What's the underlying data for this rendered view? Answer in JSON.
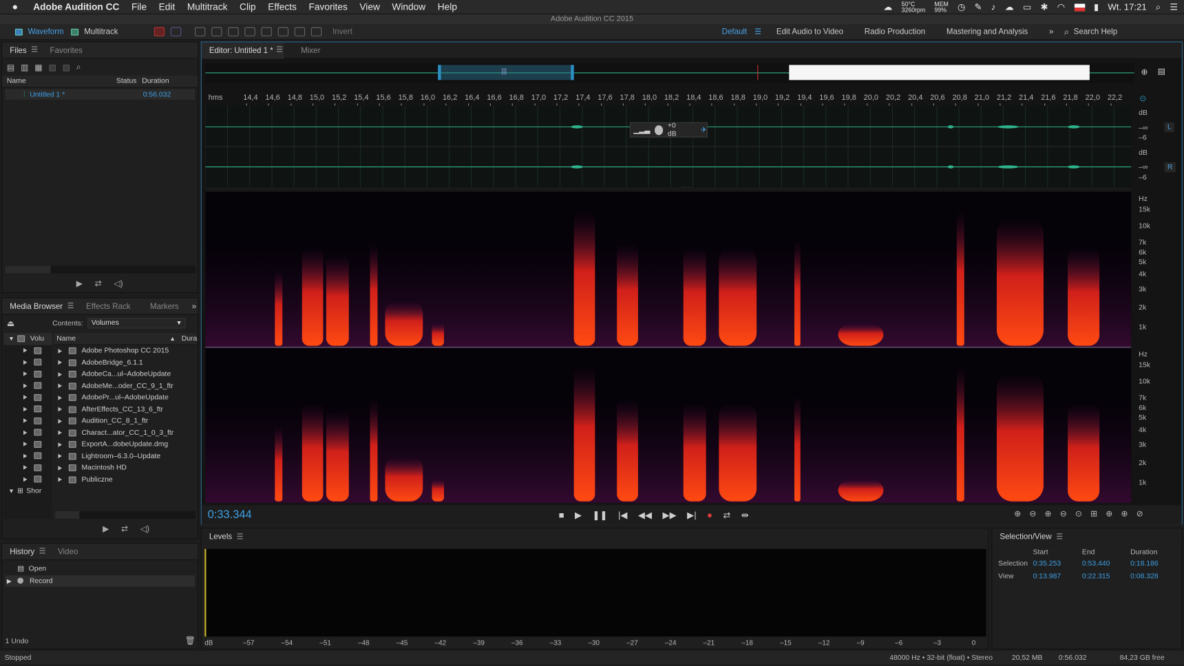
{
  "menubar": {
    "app": "Adobe Audition CC",
    "items": [
      "File",
      "Edit",
      "Multitrack",
      "Clip",
      "Effects",
      "Favorites",
      "View",
      "Window",
      "Help"
    ],
    "status": {
      "temp": "50°C",
      "rpm": "3260rpm",
      "mem_label": "MEM",
      "mem": "99%",
      "clock": "Wt. 17:21"
    }
  },
  "window_title": "Adobe Audition CC 2015",
  "toolbar": {
    "waveform": "Waveform",
    "multitrack": "Multitrack",
    "invert": "Invert",
    "workspaces": [
      "Default",
      "Edit Audio to Video",
      "Radio Production",
      "Mastering and Analysis"
    ],
    "search": "Search Help"
  },
  "files": {
    "tabs": [
      "Files",
      "Favorites"
    ],
    "columns": [
      "Name",
      "Status",
      "Duration"
    ],
    "items": [
      {
        "name": "Untitled 1 *",
        "duration": "0:56.032"
      }
    ]
  },
  "media": {
    "tabs": [
      "Media Browser",
      "Effects Rack",
      "Markers"
    ],
    "contents_label": "Contents:",
    "contents_value": "Volumes",
    "tree_root": "Volu",
    "tree_shortcut": "Shor",
    "columns": [
      "Name",
      "Dura"
    ],
    "items": [
      "Adobe Photoshop CC 2015",
      "AdobeBridge_6.1.1",
      "AdobeCa...ul–AdobeUpdate",
      "AdobeMe...oder_CC_9_1_ftr",
      "AdobePr...ul–AdobeUpdate",
      "AfterEffects_CC_13_6_ftr",
      "Audition_CC_8_1_ftr",
      "Charact...ator_CC_1_0_3_ftr",
      "ExportA...dobeUpdate.dmg",
      "Lightroom–6.3.0–Update",
      "Macintosh HD",
      "Publiczne"
    ]
  },
  "history": {
    "tabs": [
      "History",
      "Video"
    ],
    "items": [
      "Open",
      "Record"
    ],
    "undo": "1 Undo"
  },
  "status_left": "Stopped",
  "editor": {
    "tabs": [
      "Editor: Untitled 1 *",
      "Mixer"
    ],
    "ruler_unit": "hms",
    "ticks": [
      "14,4",
      "14,6",
      "14,8",
      "15,0",
      "15,2",
      "15,4",
      "15,6",
      "15,8",
      "16,0",
      "16,2",
      "16,4",
      "16,6",
      "16,8",
      "17,0",
      "17,2",
      "17,4",
      "17,6",
      "17,8",
      "18,0",
      "18,2",
      "18,4",
      "18,6",
      "18,8",
      "19,0",
      "19,2",
      "19,4",
      "19,6",
      "19,8",
      "20,0",
      "20,2",
      "20,4",
      "20,6",
      "20,8",
      "21,0",
      "21,2",
      "21,4",
      "21,6",
      "21,8",
      "22,0",
      "22,2"
    ],
    "hud_gain": "+0 dB",
    "db_scale": [
      "dB",
      "–∞",
      "–6"
    ],
    "channels": [
      "L",
      "R"
    ],
    "hz_scale": [
      "Hz",
      "15k",
      "10k",
      "7k",
      "6k",
      "5k",
      "4k",
      "3k",
      "2k",
      "1k"
    ],
    "current_time": "0:33.344"
  },
  "levels": {
    "title": "Levels",
    "scale": [
      "dB",
      "–57",
      "–54",
      "–51",
      "–48",
      "–45",
      "–42",
      "–39",
      "–36",
      "–33",
      "–30",
      "–27",
      "–24",
      "–21",
      "–18",
      "–15",
      "–12",
      "–9",
      "–6",
      "–3",
      "0"
    ]
  },
  "selview": {
    "title": "Selection/View",
    "headers": [
      "Start",
      "End",
      "Duration"
    ],
    "rows": [
      {
        "label": "Selection",
        "start": "0:35.253",
        "end": "0:53.440",
        "dur": "0:18.186"
      },
      {
        "label": "View",
        "start": "0:13.987",
        "end": "0:22.315",
        "dur": "0:08.328"
      }
    ]
  },
  "statusbar": {
    "format": "48000 Hz • 32-bit (float) • Stereo",
    "size": "20,52 MB",
    "duration": "0:56.032",
    "free": "84,23 GB free"
  },
  "colors": {
    "accent": "#3ea0e6",
    "waveform": "#2fb38c",
    "spectral_hot": "#ff3a10"
  }
}
